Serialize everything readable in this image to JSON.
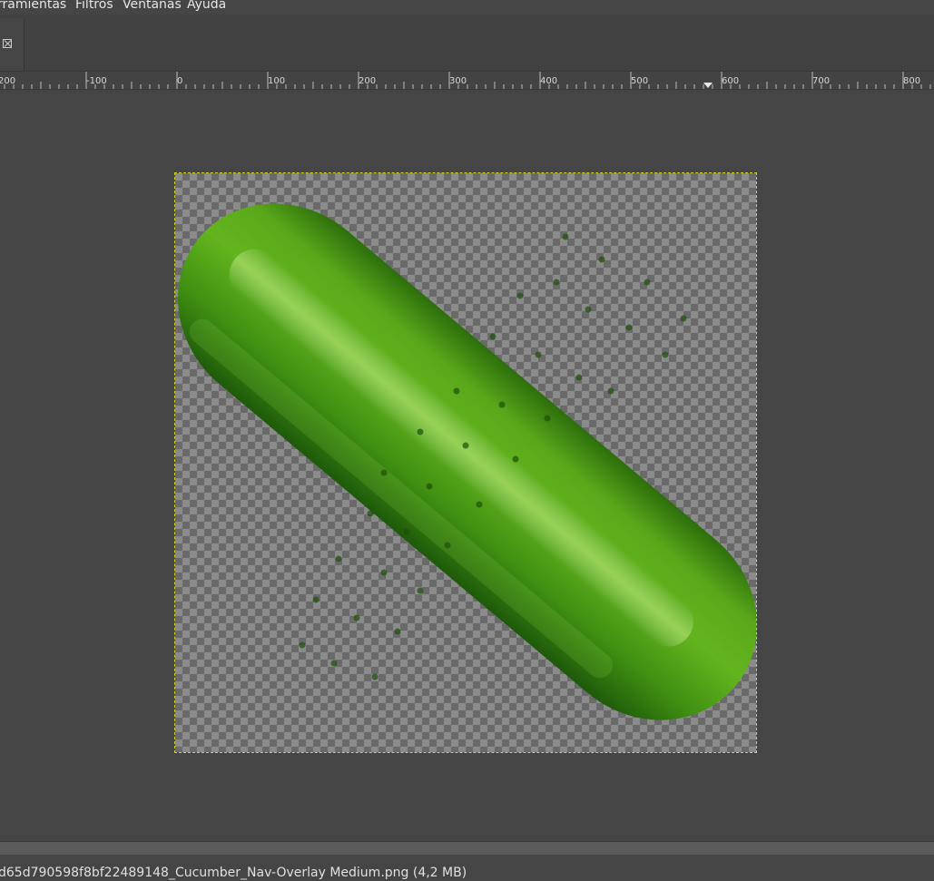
{
  "menubar": {
    "items": [
      {
        "label": "rramientas"
      },
      {
        "label": "Filtros"
      },
      {
        "label": "Ventanas"
      },
      {
        "label": "Ayuda"
      }
    ]
  },
  "ruler": {
    "labels": [
      "200",
      "-100",
      "0",
      "100",
      "200",
      "300",
      "400",
      "500",
      "600",
      "700",
      "800"
    ]
  },
  "status": {
    "file_info": "d65d790598f8bf22489148_Cucumber_Nav-Overlay Medium.png (4,2 MB)"
  },
  "colors": {
    "background": "#454545",
    "selection_outline": "#d6d21c",
    "cucumber_green": "#4aa414"
  }
}
